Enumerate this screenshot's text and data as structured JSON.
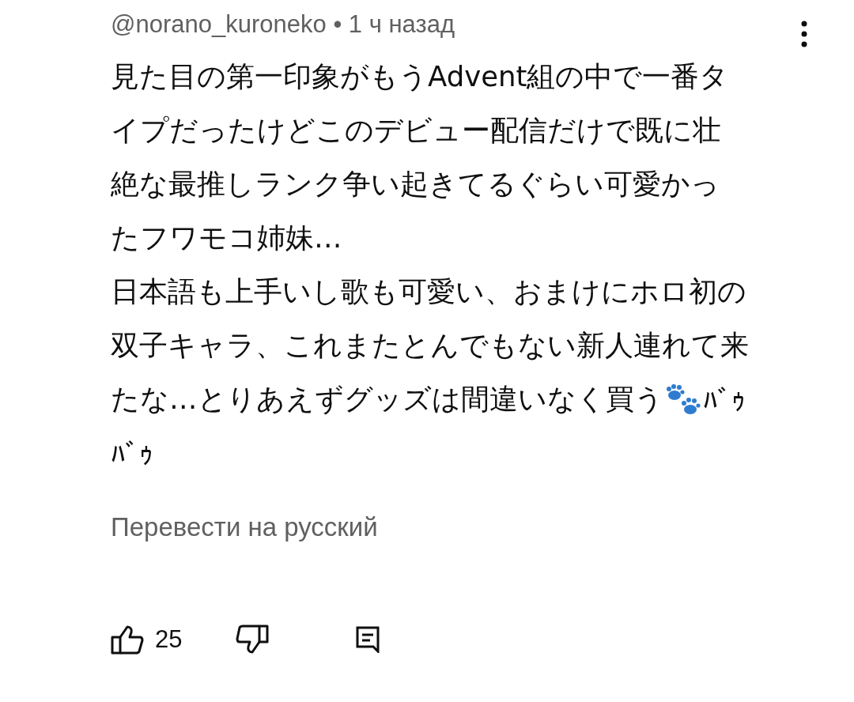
{
  "comment": {
    "meta": "@norano_kuroneko • 1 ч назад",
    "lines": [
      {
        "text": "見た目の第一印象がもうAdvent組の中で一番タ"
      },
      {
        "text": "イプだったけどこのデビュー配信だけで既に壮"
      },
      {
        "text": "絶な最推しランク争い起きてるぐらい可愛かっ"
      },
      {
        "text": "たフワモコ姉妹…"
      },
      {
        "text": "日本語も上手いし歌も可愛い、おまけにホロ初の"
      },
      {
        "text": "双子キャラ、これまたとんでもない新人連れて来"
      },
      {
        "text": "たな…とりあえずグッズは間違いなく買う",
        "paw": true,
        "after": "ﾊﾞｩ"
      },
      {
        "text": "ﾊﾞｩ"
      }
    ],
    "translate": "Перевести на русский",
    "likes": "25"
  }
}
